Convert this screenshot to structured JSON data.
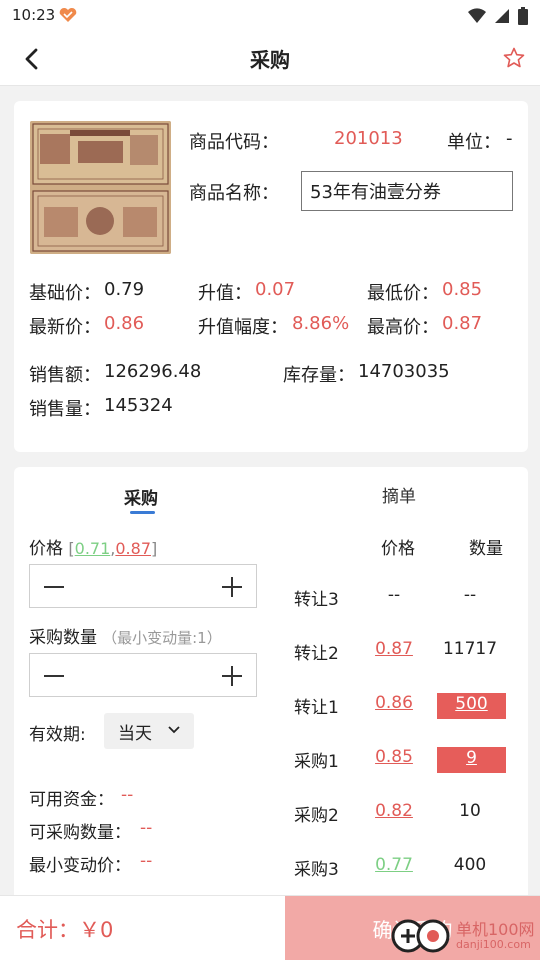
{
  "status_bar": {
    "time": "10:23"
  },
  "header": {
    "title": "采购"
  },
  "product": {
    "code_label": "商品代码：",
    "code": "201013",
    "unit_label": "单位：",
    "unit": "-",
    "name_label": "商品名称：",
    "name": "53年有油壹分券"
  },
  "prices": {
    "base_label": "基础价：",
    "base": "0.79",
    "rise_label": "升值：",
    "rise": "0.07",
    "low_label": "最低价：",
    "low": "0.85",
    "latest_label": "最新价：",
    "latest": "0.86",
    "rise_pct_label": "升值幅度：",
    "rise_pct": "8.86%",
    "high_label": "最高价：",
    "high": "0.87"
  },
  "stats": {
    "sales_amount_label": "销售额：",
    "sales_amount": "126296.48",
    "stock_label": "库存量：",
    "stock": "14703035",
    "sales_qty_label": "销售量：",
    "sales_qty": "145324"
  },
  "tabs": {
    "purchase": "采购",
    "order": "摘单"
  },
  "form": {
    "price_label": "价格",
    "bracket_open": "[",
    "range_low": "0.71",
    "range_sep": ",",
    "range_high": "0.87",
    "bracket_close": "]",
    "qty_label": "采购数量",
    "min_change_note": "（最小变动量:1）",
    "validity_label": "有效期:",
    "validity_value": "当天",
    "funds_label": "可用资金：",
    "funds": "--",
    "buyable_label": "可采购数量：",
    "buyable": "--",
    "min_price_label": "最小变动价：",
    "min_price": "--"
  },
  "orderbook": {
    "price_header": "价格",
    "qty_header": "数量",
    "rows": [
      {
        "label": "转让3",
        "price": "--",
        "qty": "--"
      },
      {
        "label": "转让2",
        "price": "0.87",
        "qty": "11717"
      },
      {
        "label": "转让1",
        "price": "0.86",
        "qty": "500"
      },
      {
        "label": "采购1",
        "price": "0.85",
        "qty": "9"
      },
      {
        "label": "采购2",
        "price": "0.82",
        "qty": "10"
      },
      {
        "label": "采购3",
        "price": "0.77",
        "qty": "400"
      }
    ]
  },
  "footer": {
    "total": "合计：￥0",
    "confirm": "确认采购"
  },
  "watermark": {
    "text": "单机100网",
    "sub": "danji100.com"
  },
  "colors": {
    "accent_red": "#e15b57",
    "green": "#7dcf84",
    "blue": "#3a7bd5",
    "confirm_bg": "#f2a9a6"
  }
}
